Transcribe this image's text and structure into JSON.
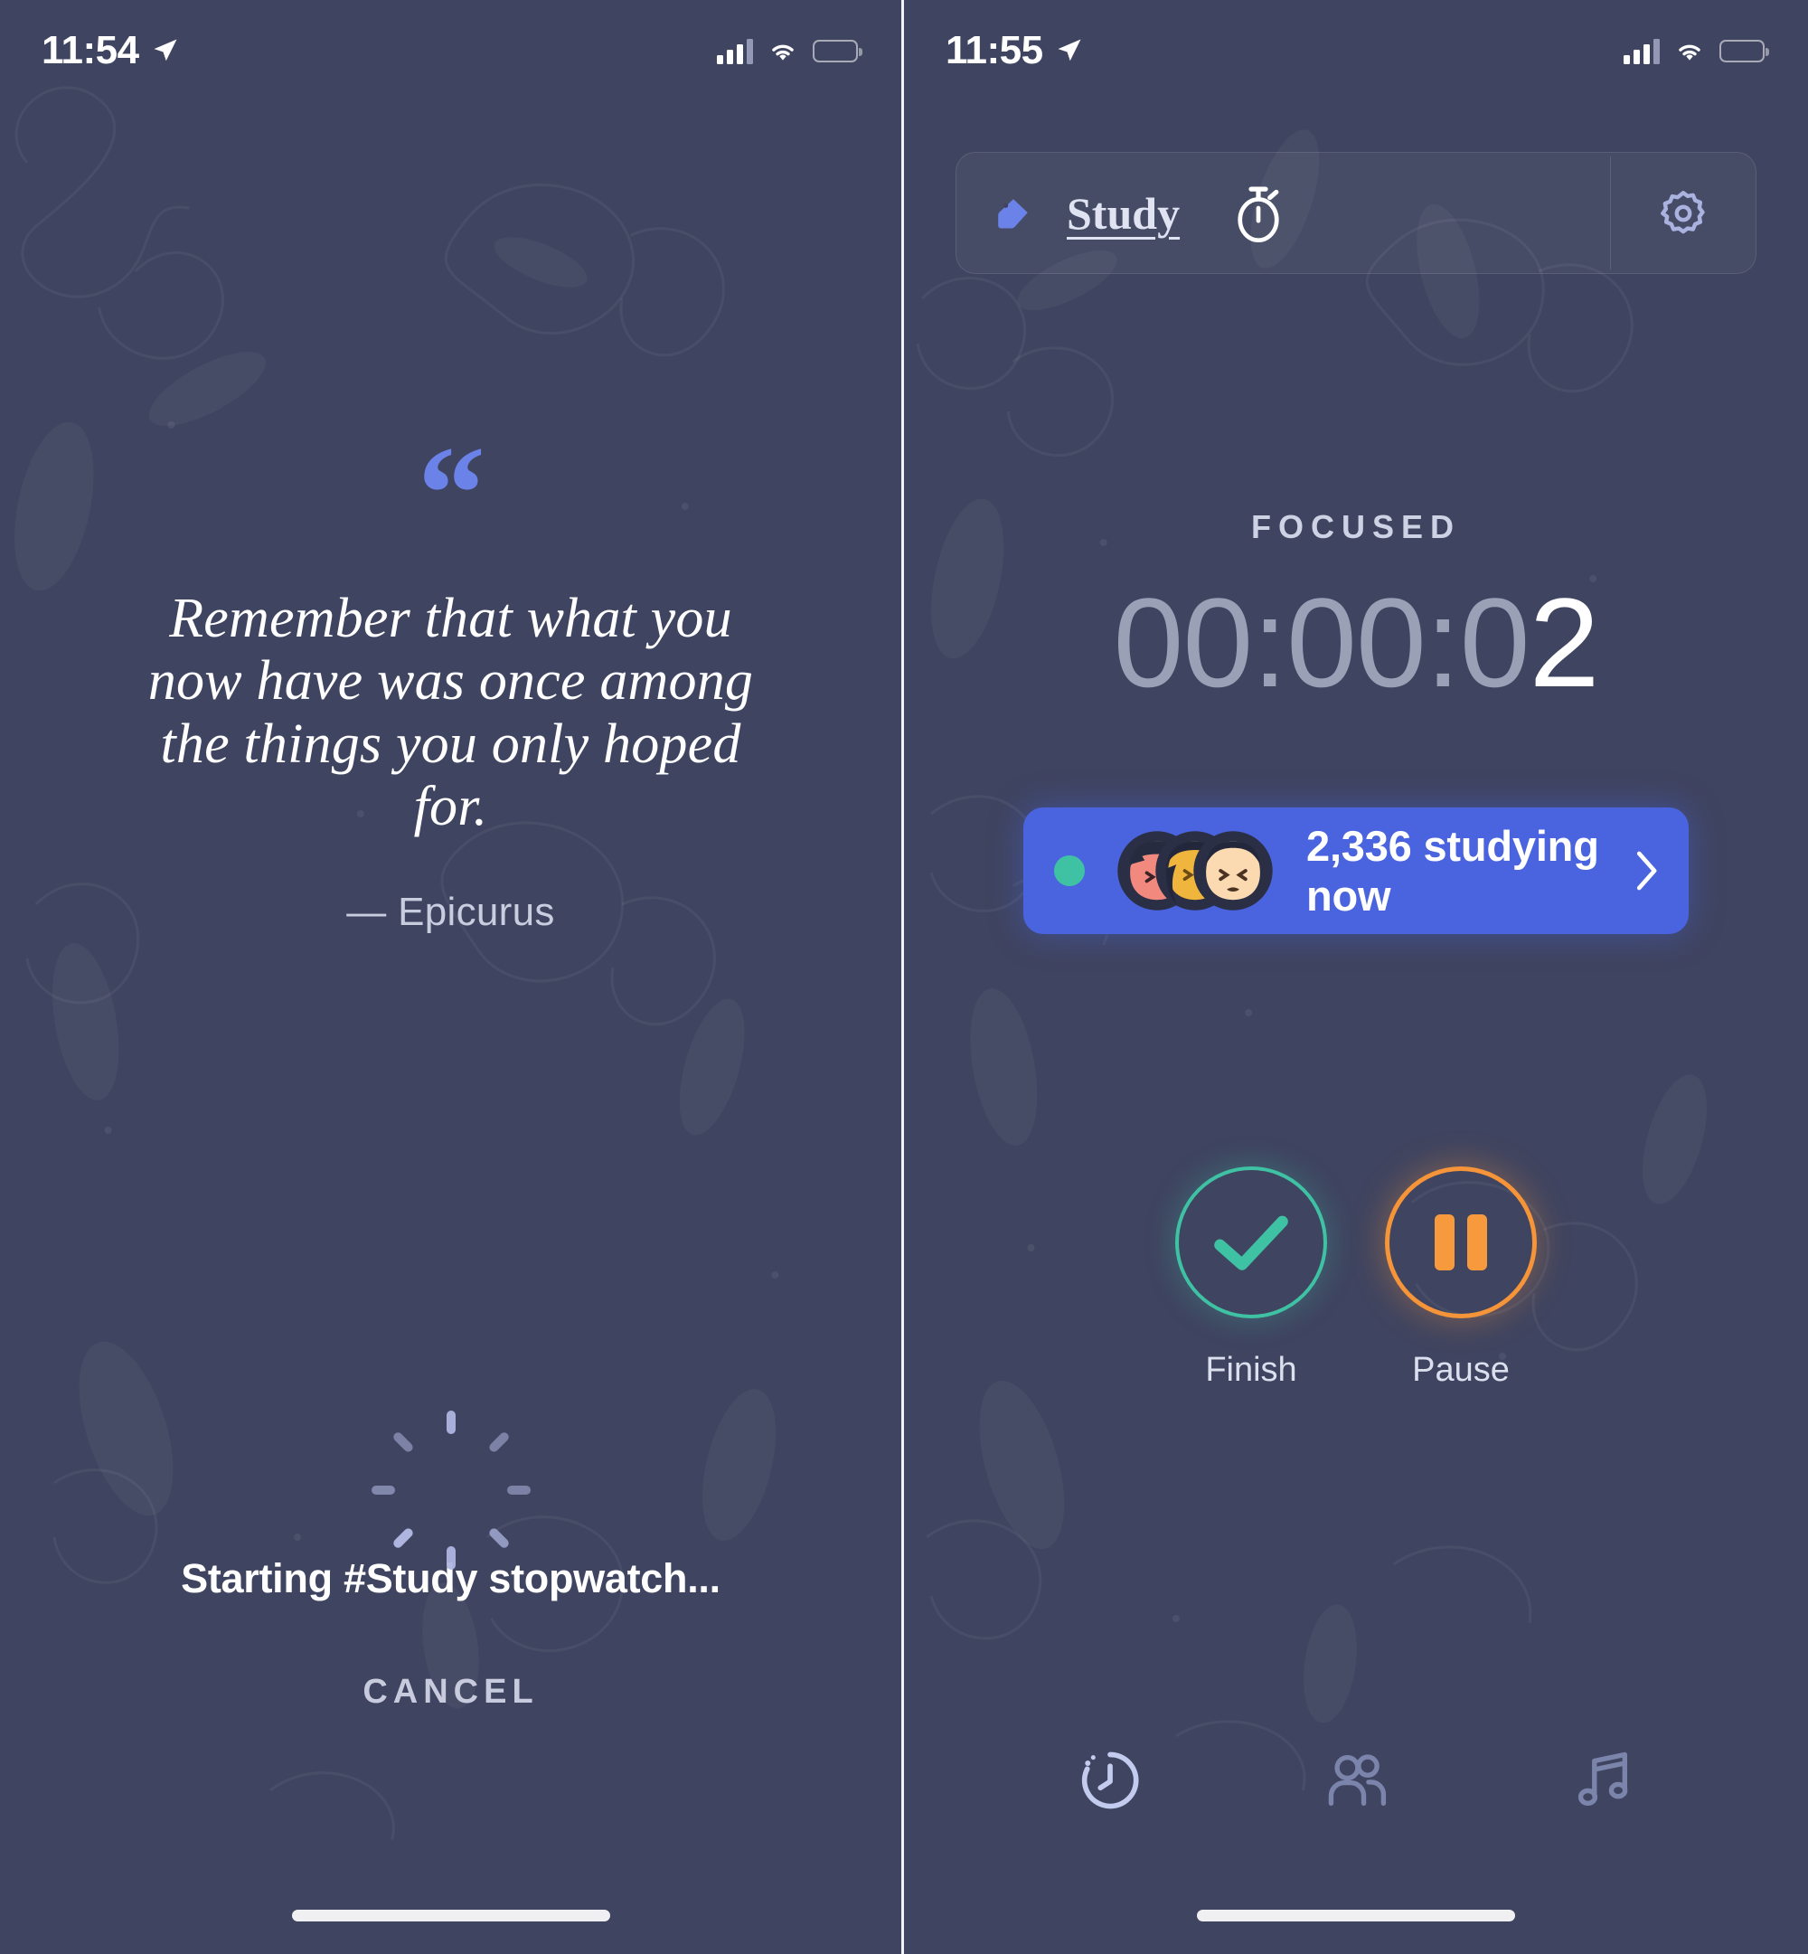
{
  "left": {
    "status": {
      "time": "11:54",
      "location_icon": "location-arrow-icon",
      "battery_level": "low"
    },
    "quote": {
      "open_quote_glyph": "“",
      "text": "Remember that what you now have was once among the things you only hoped for.",
      "author": "— Epicurus"
    },
    "loading": {
      "spinner_icon": "spinner-icon",
      "message": "Starting #Study stopwatch...",
      "cancel_label": "CANCEL"
    }
  },
  "right": {
    "status": {
      "time": "11:55",
      "location_icon": "location-arrow-icon",
      "battery_level": "low"
    },
    "toolbar": {
      "tag_icon": "tag-icon",
      "tag_label": "Study",
      "mode_icon": "stopwatch-icon",
      "settings_icon": "gear-icon"
    },
    "session": {
      "state_label": "FOCUSED",
      "timer_dim": "00:00:0",
      "timer_active": "2"
    },
    "banner": {
      "live_dot": "live-status-dot",
      "count_text": "2,336 studying now",
      "chevron_icon": "chevron-right-icon",
      "avatars": [
        "avatar-salmon",
        "avatar-gold",
        "avatar-peach"
      ]
    },
    "controls": [
      {
        "name": "finish",
        "icon": "check-icon",
        "label": "Finish"
      },
      {
        "name": "pause",
        "icon": "pause-icon",
        "label": "Pause"
      }
    ],
    "nav": [
      {
        "name": "timer",
        "icon": "clock-history-icon",
        "active": true
      },
      {
        "name": "friends",
        "icon": "people-icon",
        "active": false
      },
      {
        "name": "music",
        "icon": "music-note-icon",
        "active": false
      }
    ]
  },
  "colors": {
    "background": "#3f4460",
    "accent_blue": "#4a63de",
    "quote_mark_blue": "#6b82e8",
    "teal": "#3fc2a4",
    "orange": "#f79a3e",
    "battery_red": "#ff3b30",
    "muted_text": "#9aa0b5"
  }
}
